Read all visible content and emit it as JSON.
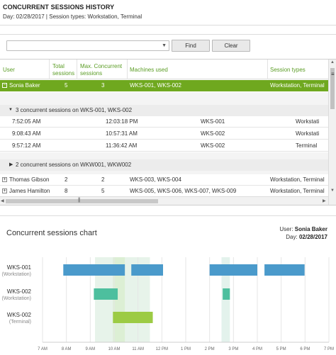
{
  "header": {
    "title": "CONCURRENT SESSIONS HISTORY",
    "subtitle": "Day: 02/28/2017 | Session types: Workstation, Terminal"
  },
  "toolbar": {
    "combo_value": "",
    "find_label": "Find",
    "clear_label": "Clear"
  },
  "grid": {
    "columns": [
      "User",
      "Total sessions",
      "Max. Concurrent sessions",
      "Machines used",
      "Session types"
    ],
    "column_lines": [
      [
        "User"
      ],
      [
        "Total",
        "sessions"
      ],
      [
        "Max. Concurrent",
        "sessions"
      ],
      [
        "Machines used"
      ],
      [
        "Session types"
      ]
    ],
    "rows": [
      {
        "expander": "−",
        "user": "Sonia Baker",
        "total": "5",
        "max": "3",
        "machines": "WKS-001, WKS-002",
        "types": "Workstation, Terminal",
        "selected": true
      },
      {
        "expander": "+",
        "user": "Thomas Gibson",
        "total": "2",
        "max": "2",
        "machines": "WKS-003, WKS-004",
        "types": "Workstation, Terminal",
        "selected": false
      },
      {
        "expander": "+",
        "user": "James Hamilton",
        "total": "8",
        "max": "5",
        "machines": "WKS-005, WKS-006, WKS-007, WKS-009",
        "types": "Workstation, Terminal",
        "selected": false
      }
    ],
    "groups": [
      {
        "label": "3 concurrent sessions on WKS-001, WKS-002",
        "expanded": true,
        "details": [
          {
            "start": "7:52:05 AM",
            "end": "12:03:18 PM",
            "machine": "WKS-001",
            "type": "Workstati"
          },
          {
            "start": "9:08:43 AM",
            "end": "10:57:31 AM",
            "machine": "WKS-002",
            "type": "Workstati"
          },
          {
            "start": "9:57:12 AM",
            "end": "11:36:42 AM",
            "machine": "WKS-002",
            "type": "Terminal"
          }
        ]
      },
      {
        "label": "2 concurrent sessions on WKW001, WKW002",
        "expanded": false,
        "details": []
      }
    ],
    "hscroll_grip": "|||"
  },
  "chart_meta": {
    "user_label": "User:",
    "user_value": "Sonia Baker",
    "day_label": "Day:",
    "day_value": "02/28/2017"
  },
  "chart_data": {
    "type": "gantt",
    "title": "Concurrent sessions chart",
    "x_ticks": [
      "7 AM",
      "8 AM",
      "9 AM",
      "10 AM",
      "11 AM",
      "12 PM",
      "1 PM",
      "2 PM",
      "3 PM",
      "4 PM",
      "5 PM",
      "6 PM",
      "7 PM"
    ],
    "x_range_hours": [
      7,
      19
    ],
    "lanes": [
      {
        "name": "WKS-001",
        "type": "(Workstation)",
        "color": "#4a9acb"
      },
      {
        "name": "WKS-002",
        "type": "(Workstation)",
        "color": "#4dbf9e"
      },
      {
        "name": "WKS-002",
        "type": "(Terminal)",
        "color": "#9ccb44"
      }
    ],
    "sessions": [
      {
        "lane": 0,
        "start": 7.87,
        "end": 10.45
      },
      {
        "lane": 0,
        "start": 10.72,
        "end": 12.05
      },
      {
        "lane": 0,
        "start": 14.0,
        "end": 16.0
      },
      {
        "lane": 0,
        "start": 16.3,
        "end": 17.98
      },
      {
        "lane": 1,
        "start": 9.15,
        "end": 10.15
      },
      {
        "lane": 1,
        "start": 14.55,
        "end": 14.85
      },
      {
        "lane": 2,
        "start": 9.95,
        "end": 11.62
      }
    ],
    "highlights": [
      {
        "start": 9.2,
        "end": 11.5,
        "color": "#e7f3ea"
      },
      {
        "start": 9.95,
        "end": 10.45,
        "color": "#dcefd4"
      },
      {
        "start": 14.5,
        "end": 14.85,
        "color": "#e3f2ec"
      }
    ]
  }
}
